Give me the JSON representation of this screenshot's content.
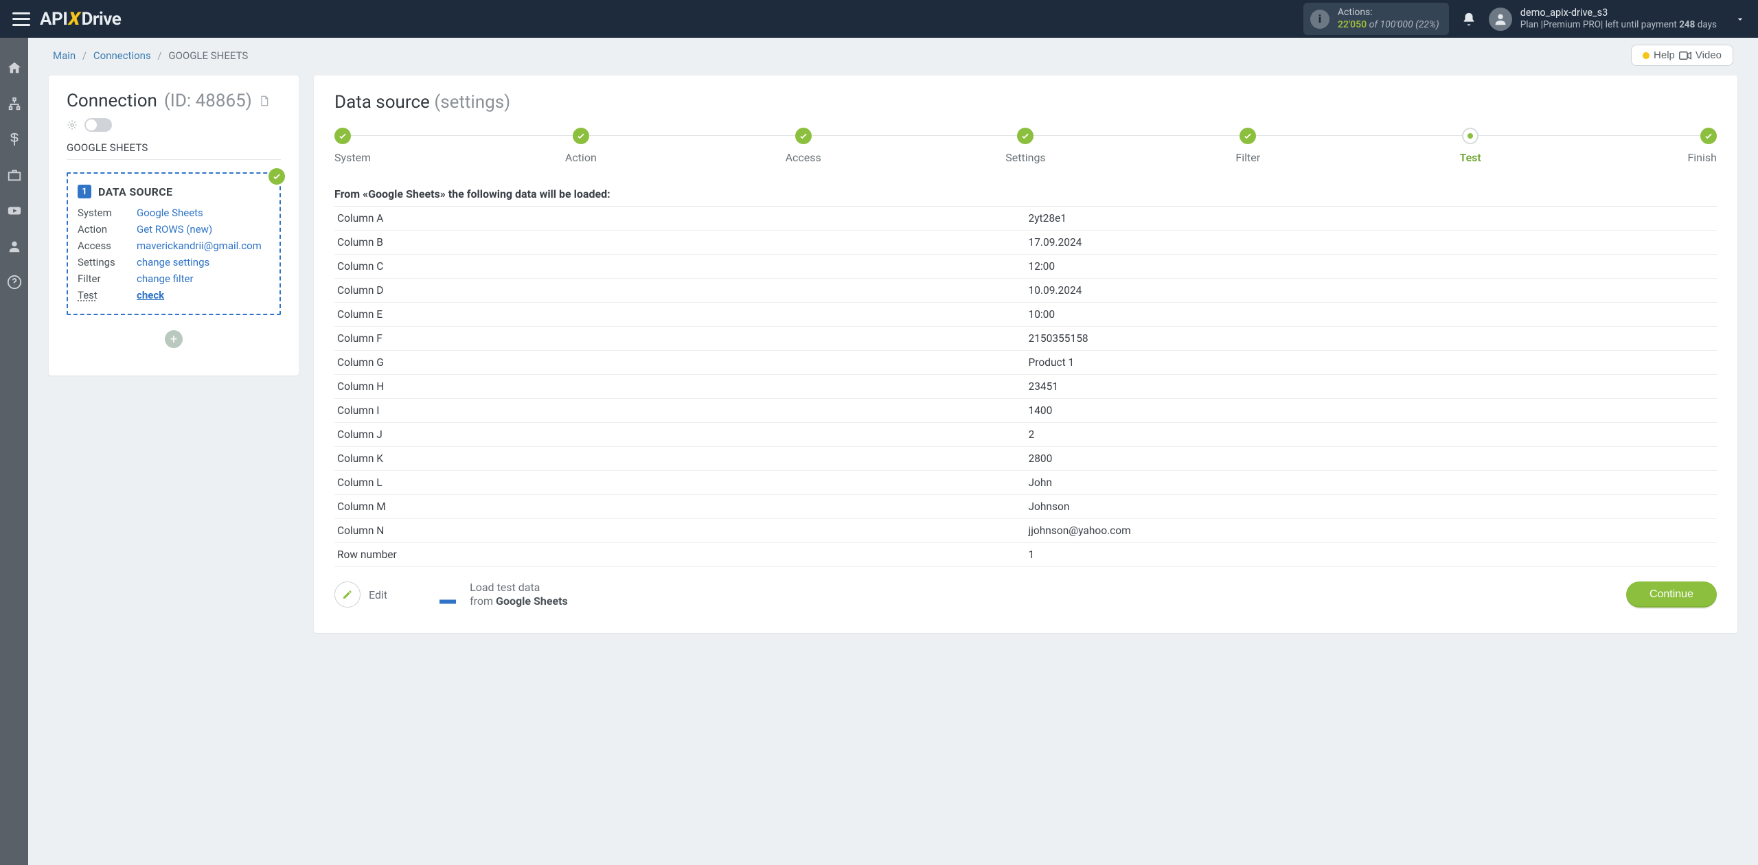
{
  "brand": {
    "pre": "API",
    "x": "X",
    "post": "Drive"
  },
  "topbar": {
    "actions_label": "Actions:",
    "actions_used": "22'050",
    "actions_of": " of ",
    "actions_total": "100'000",
    "actions_pct": " (22%)",
    "user_name": "demo_apix-drive_s3",
    "plan_prefix": "Plan |Premium PRO| left until payment ",
    "plan_days": "248",
    "plan_suffix": " days"
  },
  "crumbs": {
    "main": "Main",
    "connections": "Connections",
    "current": "GOOGLE SHEETS"
  },
  "help": {
    "label": "Help",
    "video": "Video"
  },
  "sidecard": {
    "title": "Connection",
    "id_label": "(ID: 48865)",
    "source_name": "GOOGLE SHEETS",
    "ds_heading": "DATA SOURCE",
    "rows": {
      "system": {
        "label": "System",
        "value": "Google Sheets"
      },
      "action": {
        "label": "Action",
        "value": "Get ROWS (new)"
      },
      "access": {
        "label": "Access",
        "value": "maverickandrii@gmail.com"
      },
      "settings": {
        "label": "Settings",
        "value": "change settings"
      },
      "filter": {
        "label": "Filter",
        "value": "change filter"
      },
      "test": {
        "label": "Test",
        "value": "check"
      }
    }
  },
  "main": {
    "title": "Data source",
    "subtitle": "(settings)",
    "steps": [
      "System",
      "Action",
      "Access",
      "Settings",
      "Filter",
      "Test",
      "Finish"
    ],
    "current_step_index": 5,
    "section_heading": "From «Google Sheets» the following data will be loaded:",
    "table": [
      {
        "k": "Column A",
        "v": "2yt28e1"
      },
      {
        "k": "Column B",
        "v": "17.09.2024"
      },
      {
        "k": "Column C",
        "v": "12:00"
      },
      {
        "k": "Column D",
        "v": "10.09.2024"
      },
      {
        "k": "Column E",
        "v": "10:00"
      },
      {
        "k": "Column F",
        "v": "2150355158"
      },
      {
        "k": "Column G",
        "v": "Product 1"
      },
      {
        "k": "Column H",
        "v": "23451"
      },
      {
        "k": "Column I",
        "v": "1400"
      },
      {
        "k": "Column J",
        "v": "2"
      },
      {
        "k": "Column K",
        "v": "2800"
      },
      {
        "k": "Column L",
        "v": "John"
      },
      {
        "k": "Column M",
        "v": "Johnson"
      },
      {
        "k": "Column N",
        "v": "jjohnson@yahoo.com"
      },
      {
        "k": "Row number",
        "v": "1"
      }
    ],
    "edit_label": "Edit",
    "load_line1": "Load test data",
    "load_line2_pre": "from ",
    "load_line2_bold": "Google Sheets",
    "continue": "Continue"
  }
}
